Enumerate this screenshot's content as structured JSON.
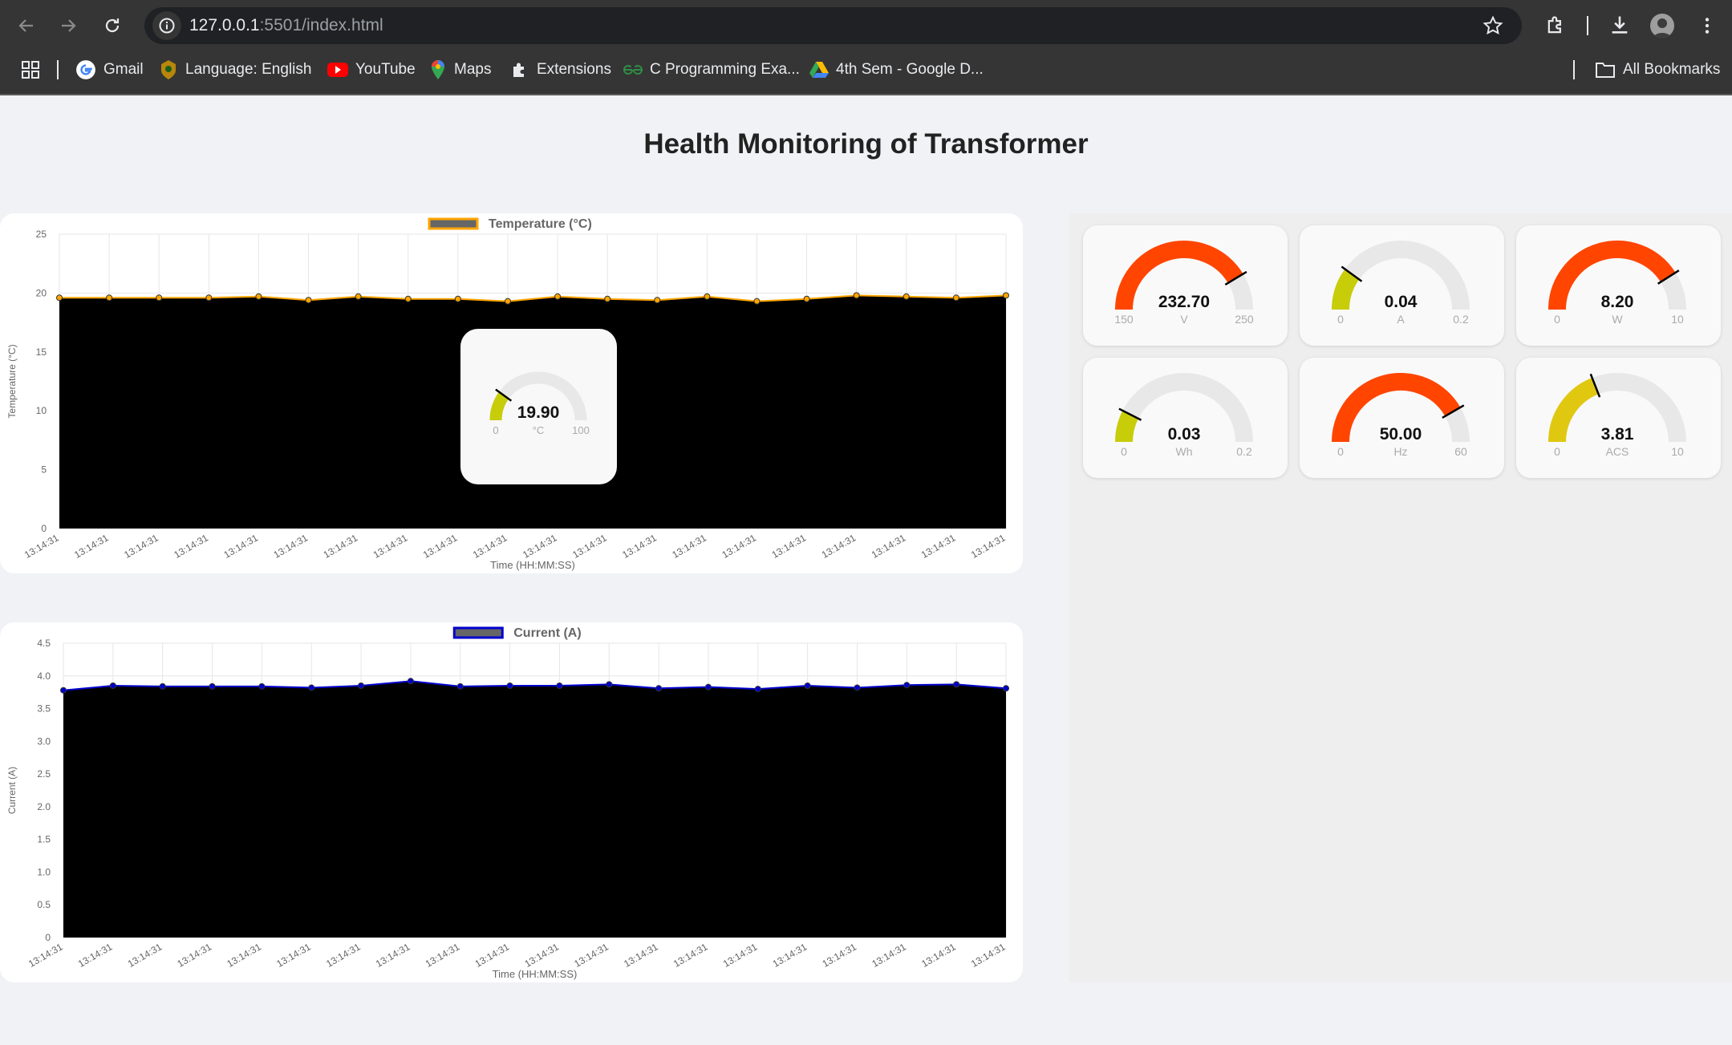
{
  "browser": {
    "url_host": "127.0.0.1",
    "url_rest": ":5501/index.html",
    "bookmarks": [
      "Gmail",
      "Language: English",
      "YouTube",
      "Maps",
      "Extensions",
      "C Programming Exa...",
      "4th Sem - Google D..."
    ],
    "all_bookmarks": "All Bookmarks"
  },
  "page": {
    "title": "Health Monitoring of Transformer"
  },
  "gauges": [
    {
      "value": "232.70",
      "unit": "V",
      "min": "150",
      "max": "250",
      "level": 0.827,
      "color": "#ff4500"
    },
    {
      "value": "0.04",
      "unit": "A",
      "min": "0",
      "max": "0.2",
      "level": 0.2,
      "color": "#c8cd0a"
    },
    {
      "value": "8.20",
      "unit": "W",
      "min": "0",
      "max": "10",
      "level": 0.82,
      "color": "#ff4500"
    },
    {
      "value": "0.03",
      "unit": "Wh",
      "min": "0",
      "max": "0.2",
      "level": 0.15,
      "color": "#c8cd0a"
    },
    {
      "value": "50.00",
      "unit": "Hz",
      "min": "0",
      "max": "60",
      "level": 0.833,
      "color": "#ff4500"
    },
    {
      "value": "3.81",
      "unit": "ACS",
      "min": "0",
      "max": "10",
      "level": 0.381,
      "color": "#e0c810"
    }
  ],
  "temp_gauge": {
    "value": "19.90",
    "unit": "°C",
    "min": "0",
    "max": "100",
    "level": 0.199,
    "color": "#c8cd0a"
  },
  "chart_data": [
    {
      "type": "area",
      "title": "",
      "legend": "Temperature (°C)",
      "legend_color": "#ffa500",
      "xlabel": "Time (HH:MM:SS)",
      "ylabel": "Temperature (°C)",
      "ylim": [
        0,
        25
      ],
      "yticks": [
        0,
        5,
        10,
        15,
        20,
        25
      ],
      "categories": [
        "13:14:31",
        "13:14:31",
        "13:14:31",
        "13:14:31",
        "13:14:31",
        "13:14:31",
        "13:14:31",
        "13:14:31",
        "13:14:31",
        "13:14:31",
        "13:14:31",
        "13:14:31",
        "13:14:31",
        "13:14:31",
        "13:14:31",
        "13:14:31",
        "13:14:31",
        "13:14:31",
        "13:14:31",
        "13:14:31"
      ],
      "series": [
        {
          "name": "Temperature (°C)",
          "values": [
            19.6,
            19.6,
            19.6,
            19.6,
            19.7,
            19.4,
            19.7,
            19.5,
            19.5,
            19.3,
            19.7,
            19.5,
            19.4,
            19.7,
            19.3,
            19.5,
            19.8,
            19.7,
            19.6,
            19.8
          ]
        }
      ],
      "fill": "#000000",
      "line_color": "#ffa500"
    },
    {
      "type": "area",
      "title": "",
      "legend": "Current (A)",
      "legend_color": "#0000cd",
      "xlabel": "Time (HH:MM:SS)",
      "ylabel": "Current (A)",
      "ylim": [
        0,
        4.5
      ],
      "yticks": [
        "0",
        "0.5",
        "1.0",
        "1.5",
        "2.0",
        "2.5",
        "3.0",
        "3.5",
        "4.0",
        "4.5"
      ],
      "categories": [
        "13:14:31",
        "13:14:31",
        "13:14:31",
        "13:14:31",
        "13:14:31",
        "13:14:31",
        "13:14:31",
        "13:14:31",
        "13:14:31",
        "13:14:31",
        "13:14:31",
        "13:14:31",
        "13:14:31",
        "13:14:31",
        "13:14:31",
        "13:14:31",
        "13:14:31",
        "13:14:31",
        "13:14:31",
        "13:14:31"
      ],
      "series": [
        {
          "name": "Current (A)",
          "values": [
            3.78,
            3.85,
            3.84,
            3.84,
            3.84,
            3.82,
            3.85,
            3.92,
            3.84,
            3.85,
            3.85,
            3.87,
            3.81,
            3.83,
            3.8,
            3.85,
            3.82,
            3.86,
            3.87,
            3.81
          ]
        }
      ],
      "fill": "#000000",
      "line_color": "#0000cd"
    }
  ]
}
